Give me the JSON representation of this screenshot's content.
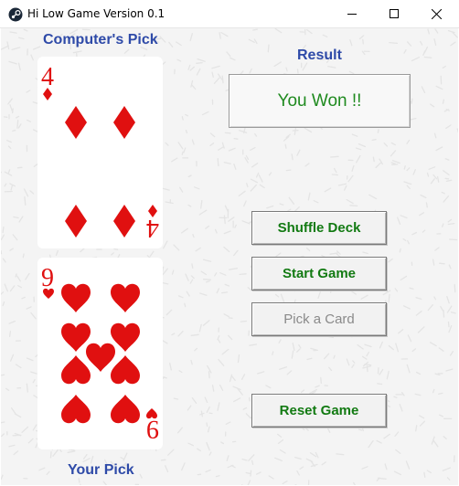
{
  "window": {
    "title": "Hi Low Game Version 0.1"
  },
  "labels": {
    "computer_pick": "Computer's Pick",
    "your_pick": "Your Pick",
    "result": "Result"
  },
  "result": {
    "text": "You Won !!"
  },
  "buttons": {
    "shuffle": "Shuffle Deck",
    "start": "Start Game",
    "pick": "Pick a Card",
    "reset": "Reset Game"
  },
  "cards": {
    "computer": {
      "rank": "4",
      "suit": "diamonds",
      "color": "#e01010"
    },
    "player": {
      "rank": "9",
      "suit": "hearts",
      "color": "#e01010"
    }
  },
  "colors": {
    "heading": "#2e4aa8",
    "button_text": "#127a12",
    "result_text": "#1f8a1f",
    "disabled_text": "#8a8a8a"
  }
}
